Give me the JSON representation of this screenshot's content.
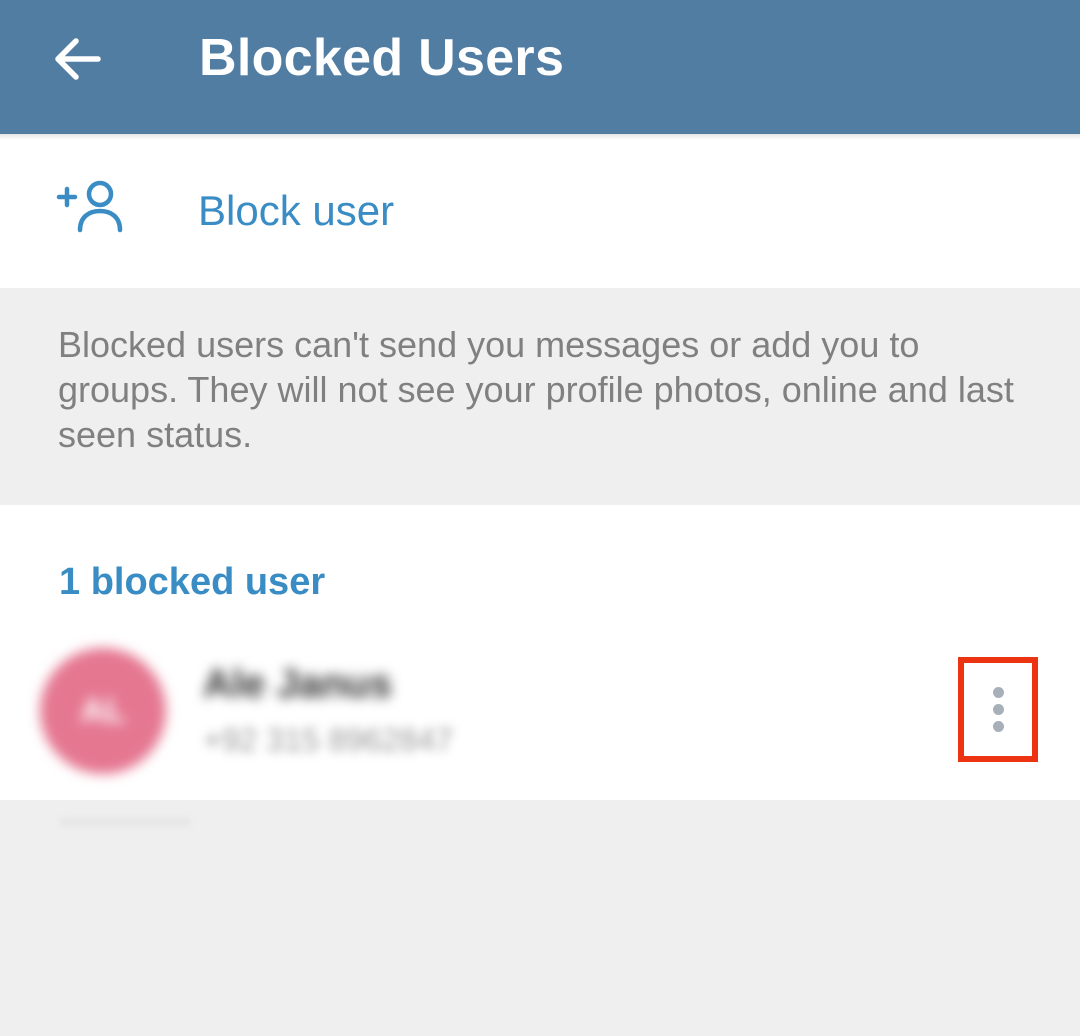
{
  "header": {
    "title": "Blocked Users",
    "back_icon": "arrow-left-icon",
    "background_color": "#527da3"
  },
  "block_user_row": {
    "icon": "add-user-icon",
    "label": "Block user",
    "accent_color": "#3a8cc4"
  },
  "info_text": "Blocked users can't send you messages or add you to groups. They will not see your profile photos, online and last seen status.",
  "blocked_list": {
    "section_header": "1 blocked user",
    "users": [
      {
        "avatar_initials": "AL",
        "avatar_color": "#e57791",
        "name": "Ale Janus",
        "phone": "+92 315 8962847",
        "menu_icon": "more-vertical-icon",
        "highlight_color": "#ec3413"
      }
    ]
  }
}
